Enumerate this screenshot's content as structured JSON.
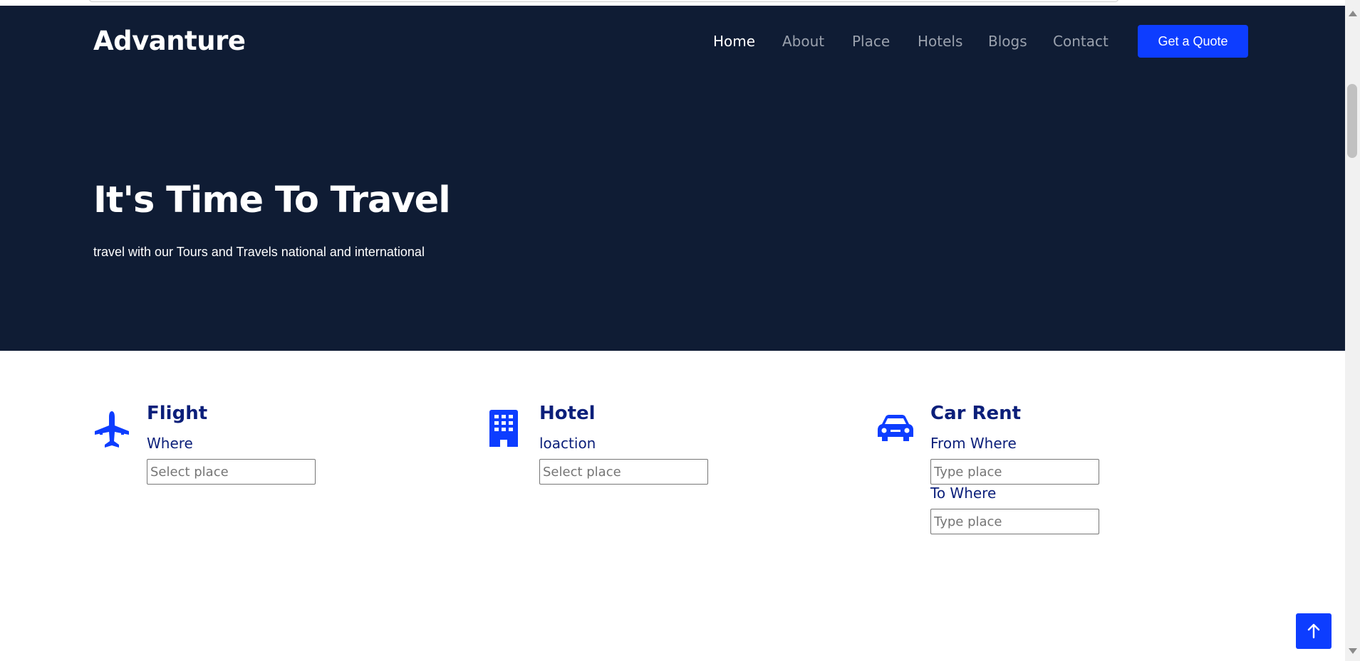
{
  "brand": "Advanture",
  "nav": [
    {
      "label": "Home",
      "active": true
    },
    {
      "label": "About",
      "active": false
    },
    {
      "label": "Place",
      "active": false
    },
    {
      "label": "Hotels",
      "active": false
    },
    {
      "label": "Blogs",
      "active": false
    },
    {
      "label": "Contact",
      "active": false
    }
  ],
  "cta_label": "Get a Quote",
  "hero": {
    "title": "It's Time To Travel",
    "subtitle": "travel with our Tours and Travels national and international"
  },
  "booking": {
    "flight": {
      "icon": "airplane-icon",
      "title": "Flight",
      "label": "Where",
      "placeholder": "Select place"
    },
    "hotel": {
      "icon": "building-icon",
      "title": "Hotel",
      "label": "loaction",
      "placeholder": "Select place"
    },
    "car": {
      "icon": "car-icon",
      "title": "Car Rent",
      "from_label": "From Where",
      "from_placeholder": "Type place",
      "to_label": "To Where",
      "to_placeholder": "Type place"
    }
  },
  "scroll_top_icon": "arrow-up-icon",
  "colors": {
    "hero_bg": "#0f1c34",
    "accent": "#0d3dff",
    "heading": "#0b1f7a",
    "nav_inactive": "#9aa1ad"
  }
}
